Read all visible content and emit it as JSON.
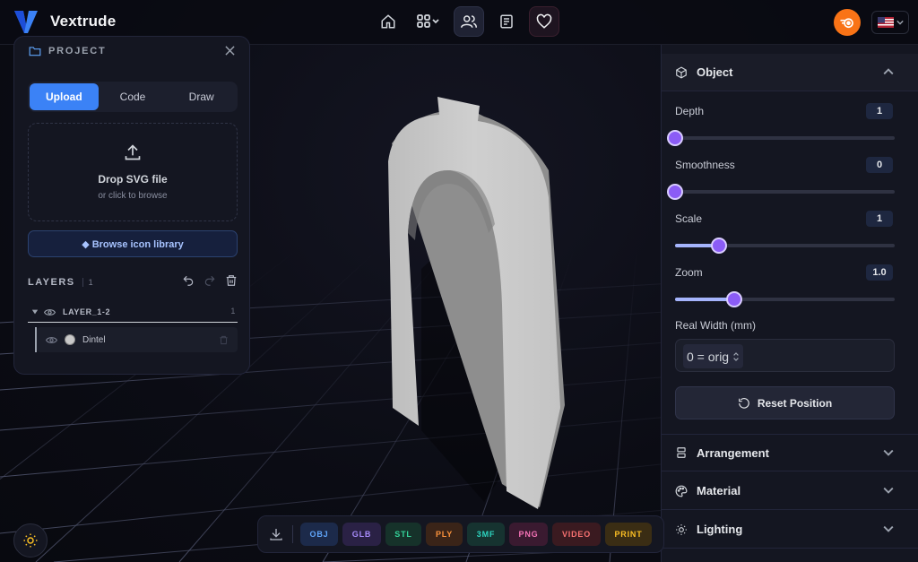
{
  "app": {
    "name": "Vextrude"
  },
  "project": {
    "title": "PROJECT",
    "tabs": [
      {
        "label": "Upload",
        "active": true
      },
      {
        "label": "Code",
        "active": false
      },
      {
        "label": "Draw",
        "active": false
      }
    ],
    "drop_title": "Drop SVG file",
    "drop_subtitle": "or click to browse",
    "browse_label": "◆ Browse icon library"
  },
  "layers": {
    "title": "LAYERS",
    "count": "1",
    "group": {
      "name": "LAYER_1-2",
      "count": "1"
    },
    "items": [
      {
        "name": "Dintel"
      }
    ]
  },
  "object_panel": {
    "title": "Object",
    "controls": [
      {
        "label": "Depth",
        "value": "1",
        "fraction": 0.0
      },
      {
        "label": "Smoothness",
        "value": "0",
        "fraction": 0.0
      },
      {
        "label": "Scale",
        "value": "1",
        "fraction": 0.2
      },
      {
        "label": "Zoom",
        "value": "1.0",
        "fraction": 0.27
      }
    ],
    "real_width_label": "Real Width (mm)",
    "real_width_value": "0 = orig",
    "reset_label": "Reset Position"
  },
  "sections": [
    {
      "title": "Arrangement",
      "icon": "arrangement-icon"
    },
    {
      "title": "Material",
      "icon": "palette-icon"
    },
    {
      "title": "Lighting",
      "icon": "sun-icon"
    }
  ],
  "export": {
    "formats": [
      {
        "label": "OBJ",
        "color": "#60a5fa",
        "bg": "#1c2a4a"
      },
      {
        "label": "GLB",
        "color": "#a78bfa",
        "bg": "#2a2145"
      },
      {
        "label": "STL",
        "color": "#34d399",
        "bg": "#16322a"
      },
      {
        "label": "PLY",
        "color": "#fb923c",
        "bg": "#3a2418"
      },
      {
        "label": "3MF",
        "color": "#2dd4bf",
        "bg": "#163330"
      },
      {
        "label": "PNG",
        "color": "#f472b6",
        "bg": "#3a1a30"
      },
      {
        "label": "VIDEO",
        "color": "#f87171",
        "bg": "#3a1a20"
      },
      {
        "label": "PRINT",
        "color": "#fbbf24",
        "bg": "#3a2d14"
      }
    ]
  }
}
